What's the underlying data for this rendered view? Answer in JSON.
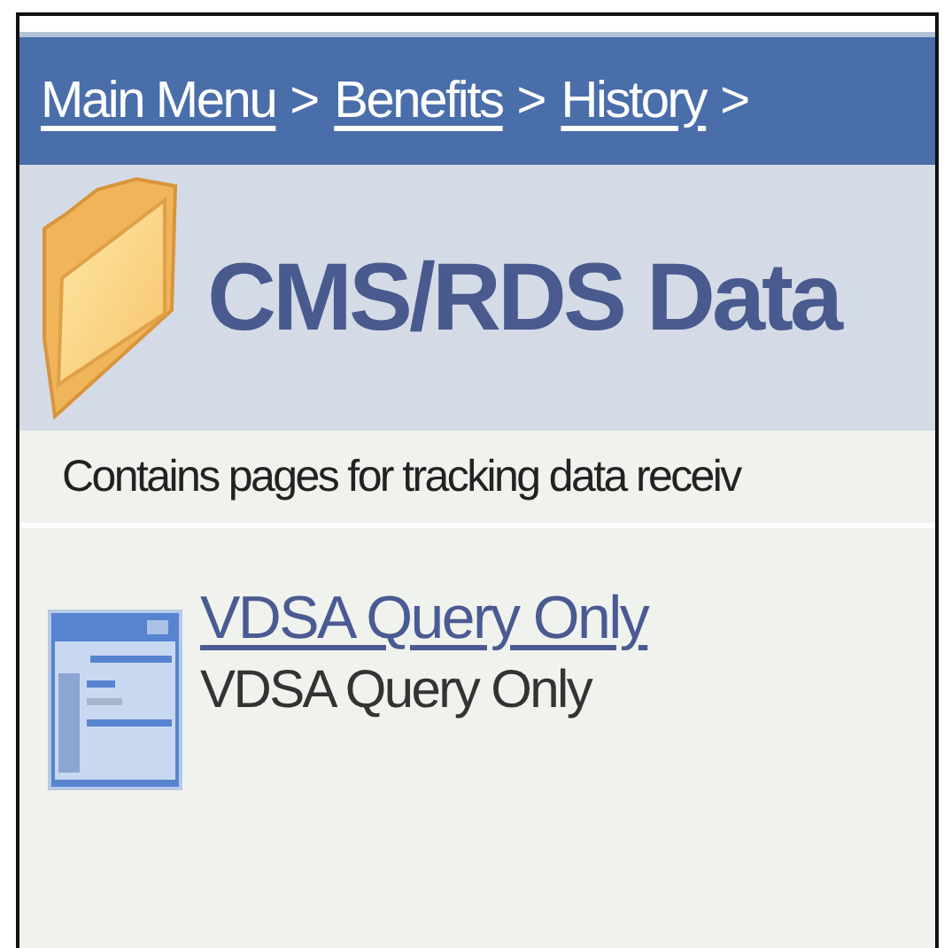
{
  "breadcrumb": [
    {
      "kind": "link",
      "text": "Main Menu"
    },
    {
      "kind": "separator",
      "text": ">"
    },
    {
      "kind": "link",
      "text": "Benefits"
    },
    {
      "kind": "separator",
      "text": ">"
    },
    {
      "kind": "link",
      "text": "History"
    },
    {
      "kind": "separator",
      "text": ">"
    }
  ],
  "header": {
    "title": "CMS/RDS Data",
    "description": "Contains pages for tracking data receiv"
  },
  "items": [
    {
      "link": "VDSA Query Only",
      "description": "VDSA Query Only"
    }
  ]
}
